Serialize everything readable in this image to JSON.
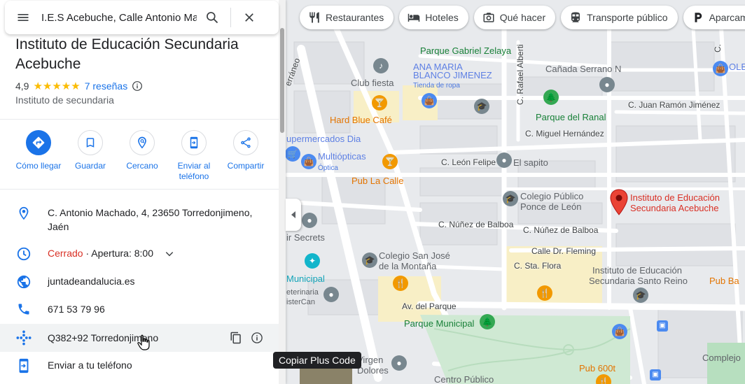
{
  "search": {
    "value": "I.E.S Acebuche, Calle Antonio Ma"
  },
  "chips": [
    {
      "label": "Restaurantes",
      "icon": "fork-knife-icon"
    },
    {
      "label": "Hoteles",
      "icon": "bed-icon"
    },
    {
      "label": "Qué hacer",
      "icon": "camera-icon"
    },
    {
      "label": "Transporte público",
      "icon": "bus-icon"
    },
    {
      "label": "Aparcamien",
      "icon": "parking-icon"
    }
  ],
  "place": {
    "title": "Instituto de Educación Secundaria Acebuche",
    "rating": "4,9",
    "stars": "★★★★★",
    "reviews": "7 reseñas",
    "category": "Instituto de secundaria"
  },
  "actions": [
    {
      "label": "Cómo llegar",
      "icon": "directions-icon"
    },
    {
      "label": "Guardar",
      "icon": "bookmark-icon"
    },
    {
      "label": "Cercano",
      "icon": "nearby-icon"
    },
    {
      "label": "Enviar al teléfono",
      "icon": "phone-send-icon"
    },
    {
      "label": "Compartir",
      "icon": "share-icon"
    }
  ],
  "info": {
    "address": "C. Antonio Machado, 4, 23650 Torredonjimeno, Jaén",
    "hours_status": "Cerrado",
    "hours_next": " · Apertura: 8:00",
    "website": "juntadeandalucia.es",
    "phone": "671 53 79 96",
    "plus_code": "Q382+92 Torredonjimeno",
    "send_to_phone": "Enviar a tu teléfono"
  },
  "tooltip": "Copiar Plus Code",
  "map_labels": {
    "parque_gabriel": "Parque Gabriel Zelaya",
    "ana_maria": "ANA MARIA",
    "blanco_jimenez": "BLANCO JIMENEZ",
    "tienda_ropa": "Tienda de ropa",
    "club_fiesta": "Club fiesta",
    "terraneo": "erráneo",
    "hard_blue": "Hard Blue Café",
    "supermercados": "upermercados Dia",
    "multiopticas": "Multiópticas",
    "optica": "Óptica",
    "pub_la_calle": "Pub La Calle",
    "rafael_alberti": "C. Rafael Alberti",
    "canada_serrano": "Cañada Serrano N",
    "parque_ranal": "Parque del Ranal",
    "juan_ramon": "C. Juan Ramón Jiménez",
    "miguel_hernandez": "C. Miguel Hernández",
    "leon_felipe": "C. León Felipe",
    "el_sapito": "El sapito",
    "colegio_ponce_1": "Colegio Público",
    "colegio_ponce_2": "Ponce de León",
    "nunez_balboa_1": "C. Núñez de Balboa",
    "nunez_balboa_2": "C. Núñez de Balboa",
    "instituto_red_1": "Instituto de Educación",
    "instituto_red_2": "Secundaria Acebuche",
    "ir_secrets": "ir Secrets",
    "colegio_sanjose_1": "Colegio San José",
    "colegio_sanjose_2": "de la Montaña",
    "dr_fleming": "Calle Dr. Fleming",
    "sta_flora": "C. Sta. Flora",
    "santo_reino_1": "Instituto de Educación",
    "santo_reino_2": "Secundaria Santo Reino",
    "pub_ba": "Pub Ba",
    "municipal": "Municipal",
    "veterinaria_1": "eterinaria",
    "veterinaria_2": "isterCan",
    "av_parque": "Av. del Parque",
    "parque_municipal": "Parque Municipal",
    "virgen_1": "Virgen",
    "virgen_2": "Dolores",
    "pub_600t": "Pub 600t",
    "centro_publico": "Centro Público",
    "complejo": "Complejo",
    "ole": "OLE",
    "c_right": "C."
  }
}
